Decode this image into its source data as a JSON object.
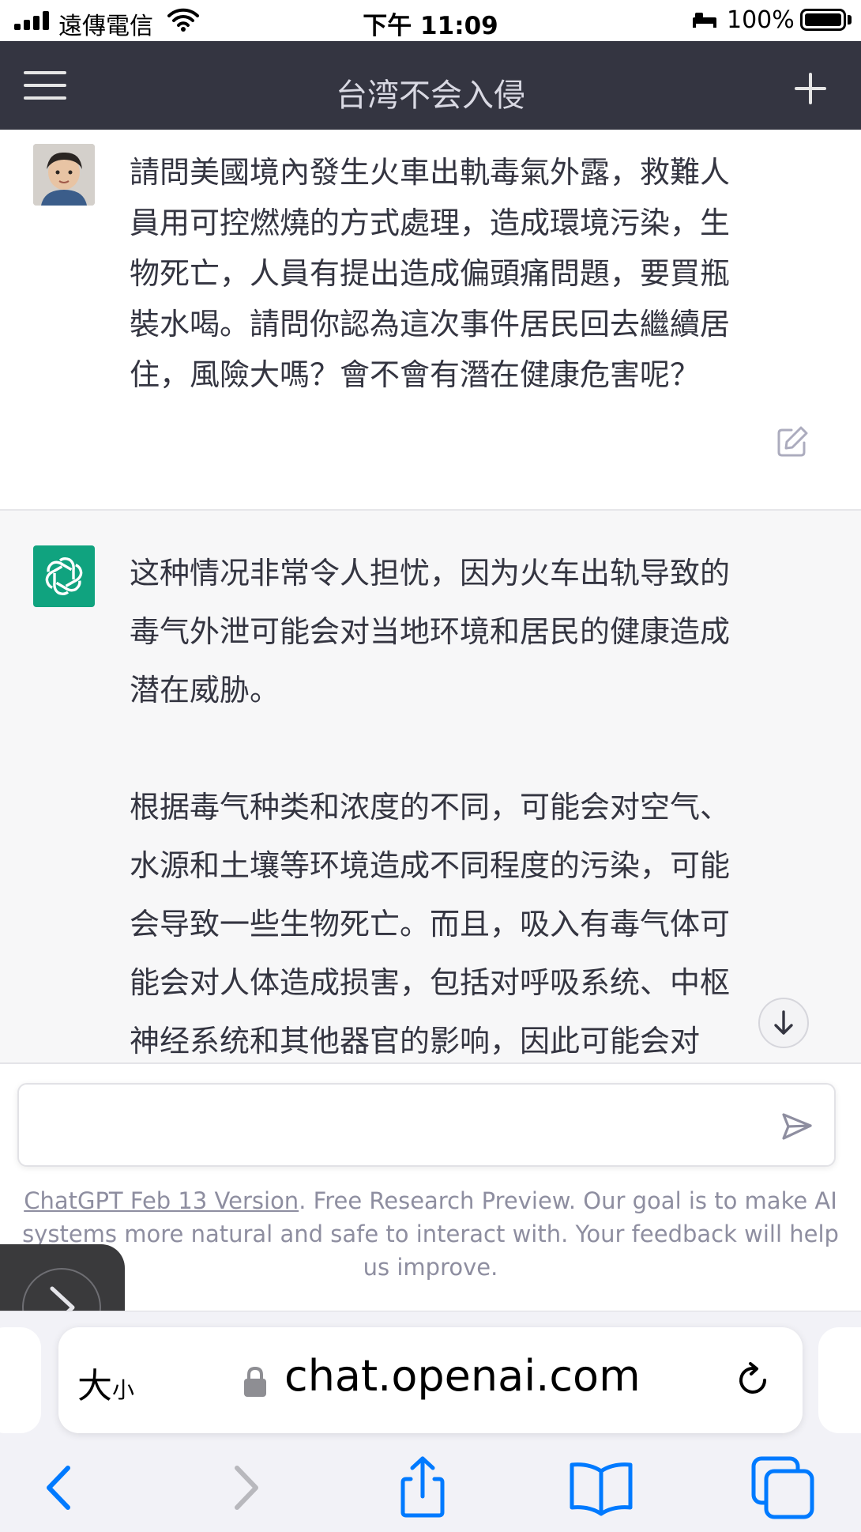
{
  "status_bar": {
    "carrier": "遠傳電信",
    "time": "下午 11:09",
    "battery": "100%"
  },
  "nav": {
    "title": "台湾不会入侵",
    "menu_icon": "hamburger-menu-icon",
    "new_chat_icon": "plus-icon"
  },
  "user_message": {
    "lines": [
      "請問美國境內發生火車出軌毒氣外露，救難人",
      "員用可控燃燒的方式處理，造成環境污染，生",
      "物死亡，人員有提出造成偏頭痛問題，要買瓶",
      "裝水喝。請問你認為這次事件居民回去繼續居",
      "住，風險大嗎？會不會有潛在健康危害呢？"
    ],
    "edit_icon": "edit-icon"
  },
  "assistant_message": {
    "p1_lines": [
      "这种情况非常令人担忧，因为火车出轨导致的",
      "毒气外泄可能会对当地环境和居民的健康造成",
      "潜在威胁。"
    ],
    "p2_lines": [
      "根据毒气种类和浓度的不同，可能会对空气、",
      "水源和土壤等环境造成不同程度的污染，可能",
      "会导致一些生物死亡。而且，吸入有毒气体可",
      "能会对人体造成损害，包括对呼吸系统、中枢",
      "神经系统和其他器官的影响，因此可能会对"
    ],
    "brand_color": "#10a37f"
  },
  "composer": {
    "placeholder": "",
    "send_icon": "send-icon"
  },
  "footer": {
    "link_text": "ChatGPT Feb 13 Version",
    "text": ". Free Research Preview. Our goal is to make AI systems more natural and safe to interact with. Your feedback will help us improve."
  },
  "safari": {
    "text_size_big": "大",
    "text_size_small": "小",
    "url": "chat.openai.com",
    "toolbar_icons": [
      "back-icon",
      "forward-icon",
      "share-icon",
      "bookmarks-icon",
      "tabs-icon"
    ],
    "accent_color": "#007aff"
  }
}
